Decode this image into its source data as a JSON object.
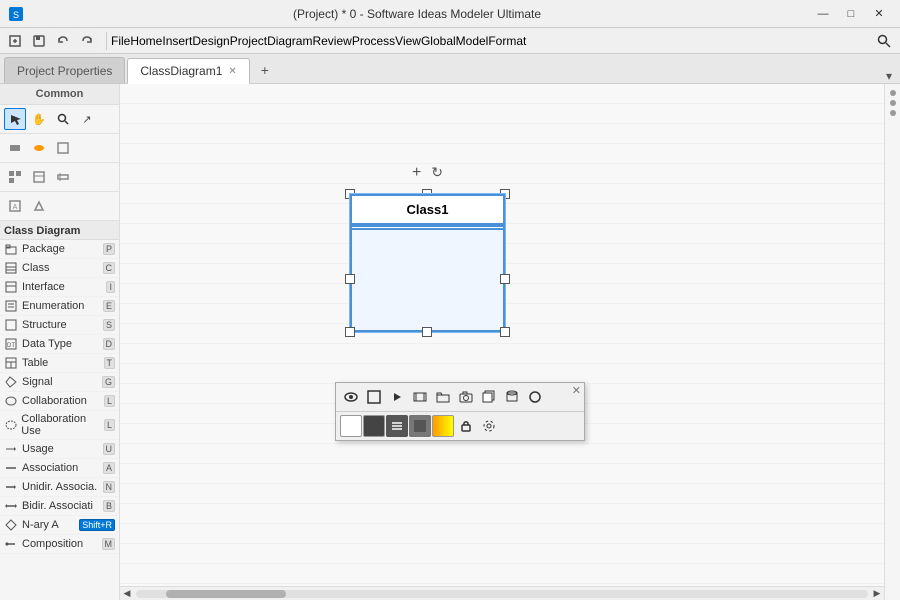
{
  "titlebar": {
    "title": "(Project) * 0 - Software Ideas Modeler Ultimate",
    "min_btn": "—",
    "max_btn": "□",
    "close_btn": "✕"
  },
  "menubar": {
    "items": [
      "File",
      "Home",
      "Insert",
      "Design",
      "Project",
      "Diagram",
      "Review",
      "Process",
      "View",
      "Global",
      "Model",
      "Format"
    ]
  },
  "tabs": [
    {
      "label": "Project Properties",
      "active": false,
      "closable": false
    },
    {
      "label": "ClassDiagram1",
      "active": true,
      "closable": true
    }
  ],
  "sidebar": {
    "common_label": "Common",
    "class_diagram_label": "Class Diagram",
    "toolbar_rows": [
      [
        "↖",
        "✋",
        "🔍",
        "↗"
      ],
      [
        "⬛",
        "⬜",
        "⬛"
      ],
      [
        "⬜",
        "⬜",
        "⬜"
      ],
      [
        "◻",
        "◻"
      ]
    ],
    "items": [
      {
        "label": "Package",
        "key": "P",
        "icon": "pkg"
      },
      {
        "label": "Class",
        "key": "C",
        "icon": "cls"
      },
      {
        "label": "Interface",
        "key": "I",
        "icon": "ifc"
      },
      {
        "label": "Enumeration",
        "key": "E",
        "icon": "enm"
      },
      {
        "label": "Structure",
        "key": "S",
        "icon": "str"
      },
      {
        "label": "Data Type",
        "key": "D",
        "icon": "dt"
      },
      {
        "label": "Table",
        "key": "T",
        "icon": "tbl"
      },
      {
        "label": "Signal",
        "key": "G",
        "icon": "sig"
      },
      {
        "label": "Collaboration",
        "key": "L",
        "icon": "col"
      },
      {
        "label": "Collaboration Use",
        "key": "L",
        "icon": "cou"
      },
      {
        "label": "Usage",
        "key": "U",
        "icon": "usg"
      },
      {
        "label": "Association",
        "key": "A",
        "icon": "asc"
      },
      {
        "label": "Unidir. Associa.",
        "key": "N",
        "icon": "unasc"
      },
      {
        "label": "Bidir. Associati",
        "key": "B",
        "icon": "biasc"
      },
      {
        "label": "N-ary A",
        "key": "Shift+R",
        "icon": "nary"
      },
      {
        "label": "Composition",
        "key": "M",
        "icon": "comp"
      }
    ]
  },
  "canvas": {
    "class_name": "Class1"
  },
  "float_toolbar": {
    "row1_icons": [
      "👁",
      "🔲",
      "⏯",
      "🎞",
      "📁",
      "📷",
      "🔲",
      "🔲"
    ],
    "row2_colors": [
      "white",
      "black",
      "≡",
      "■",
      "🎨",
      "🔒",
      "⚙"
    ],
    "close": "✕"
  }
}
